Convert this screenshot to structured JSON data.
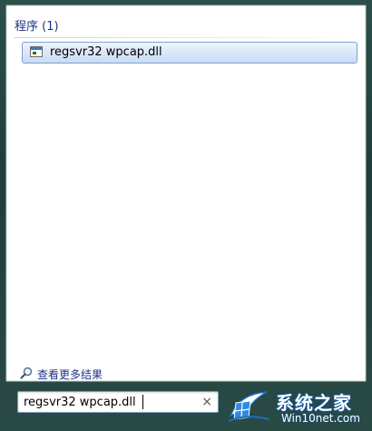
{
  "results_group": {
    "title": "程序 (1)",
    "items": [
      {
        "label": "regsvr32 wpcap.dll",
        "icon": "application-icon"
      }
    ]
  },
  "more_results": {
    "label": "查看更多结果",
    "icon": "magnifier-icon"
  },
  "search": {
    "value": "regsvr32 wpcap.dll",
    "clear_glyph": "×"
  },
  "watermark": {
    "title": "系统之家",
    "url": "Win10net.com"
  }
}
